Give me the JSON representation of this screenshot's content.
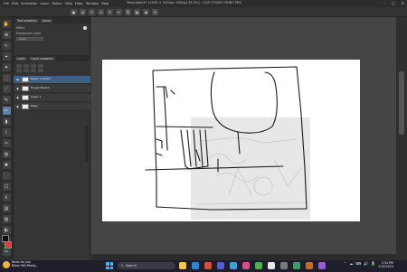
{
  "window": {
    "title": "Template01* (1000 × 1000px 350dpi 33.5%) - CLIP STUDIO PAINT PRO",
    "menu": [
      "File",
      "Edit",
      "Animation",
      "Layer",
      "Select",
      "View",
      "Filter",
      "Window",
      "Help"
    ],
    "controls": [
      "–",
      "□",
      "✕"
    ]
  },
  "command_bar": [
    "▣",
    "⊞",
    "✎",
    "⟲",
    "⟳",
    "✂",
    "⎘",
    "▦",
    "◉",
    "⚙"
  ],
  "tools": [
    "✋",
    "⊕",
    "↖",
    "⌖",
    "✦",
    "⬚",
    "⟋",
    "✎",
    "✏",
    "▮",
    "⌇",
    "✑",
    "◍",
    "✸",
    "⬛",
    "☐",
    "ℹ",
    "▤",
    "▥",
    "◐",
    "✐",
    "✂",
    "⌸",
    "◨",
    "◧",
    "◪"
  ],
  "colors": {
    "main_color": "#111111",
    "sub_color": "#e53935",
    "accent": "#3f5f86"
  },
  "properties": {
    "tab": "Tool property",
    "tool_name": "Lasso",
    "row1_label": "Effect",
    "row2_label": "Expression color",
    "row2_value": "Color"
  },
  "layers": {
    "tabs": [
      "Layer",
      "Layer property"
    ],
    "items": [
      {
        "name": "Paper 1 Sketch",
        "selected": true
      },
      {
        "name": "Rough Sketch",
        "selected": false
      },
      {
        "name": "Layer 1",
        "selected": false
      },
      {
        "name": "Paper",
        "selected": false
      }
    ]
  },
  "taskbar": {
    "weather_title": "News for you",
    "weather_sub": "Biden Will Really...",
    "search_placeholder": "Search",
    "tray_icons": [
      "⌃",
      "☁",
      "⌨",
      "🔊",
      "🔋"
    ],
    "time": "2:34 PM",
    "date": "7/15/2024"
  }
}
